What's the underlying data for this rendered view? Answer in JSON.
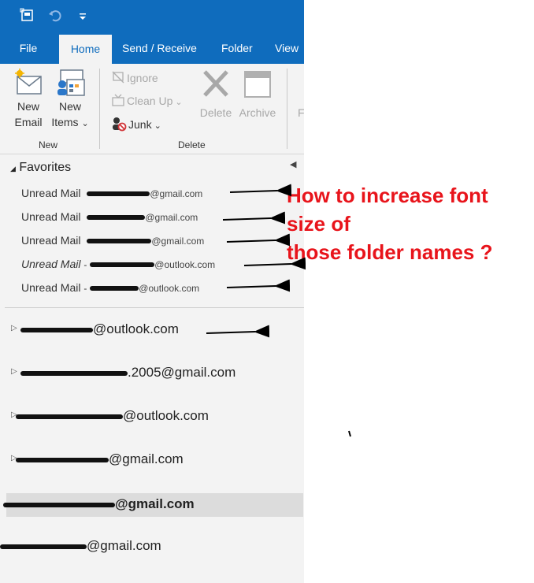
{
  "quick_access": {
    "icons": [
      "save-folder-icon",
      "undo-icon",
      "customize-dropdown-icon"
    ]
  },
  "tabs": [
    {
      "label": "File",
      "active": false
    },
    {
      "label": "Home",
      "active": true
    },
    {
      "label": "Send / Receive",
      "active": false
    },
    {
      "label": "Folder",
      "active": false
    },
    {
      "label": "View",
      "active": false
    }
  ],
  "ribbon": {
    "new_group": {
      "label": "New",
      "new_email": {
        "line1": "New",
        "line2": "Email"
      },
      "new_items": {
        "line1": "New",
        "line2": "Items",
        "arrow": "⌄"
      }
    },
    "delete_group": {
      "label": "Delete",
      "ignore": "Ignore",
      "clean_up": "Clean Up",
      "junk": "Junk",
      "delete": "Delete",
      "archive": "Archive",
      "respond_partial": "F"
    }
  },
  "folders": {
    "favorites_title": "Favorites",
    "favorites": [
      {
        "label": "Unread Mail",
        "account_suffix": "@gmail.com"
      },
      {
        "label": "Unread Mail",
        "account_suffix": "@gmail.com"
      },
      {
        "label": "Unread Mail",
        "account_suffix": "@gmail.com"
      },
      {
        "label": "Unread Mail",
        "account_suffix": "@outlook.com",
        "sep": "-"
      },
      {
        "label": "Unread Mail",
        "account_suffix": "@outlook.com",
        "sep": "-"
      }
    ],
    "accounts": [
      {
        "suffix": "@outlook.com"
      },
      {
        "suffix": ".2005@gmail.com"
      },
      {
        "suffix": "@outlook.com"
      },
      {
        "suffix": "@gmail.com"
      },
      {
        "suffix": "@gmail.com",
        "selected": true
      },
      {
        "suffix": "@gmail.com"
      }
    ]
  },
  "annotation": {
    "line1": "How to increase font",
    "line2": "size of",
    "line3": "those folder names ?"
  },
  "colors": {
    "accent": "#0f6cbd",
    "annotation": "#e8141b"
  }
}
